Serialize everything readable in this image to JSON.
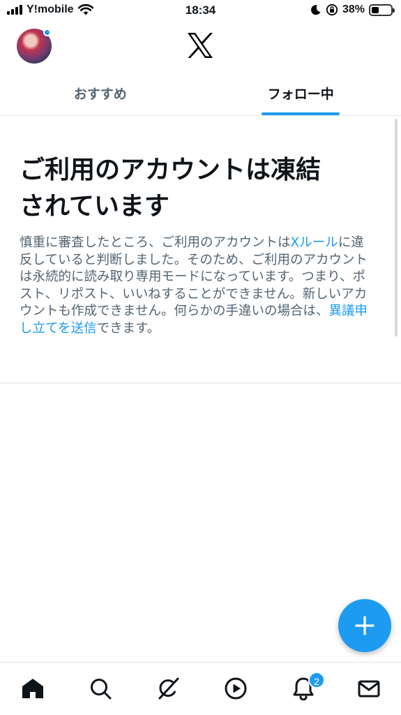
{
  "status_bar": {
    "carrier": "Y!mobile",
    "time": "18:34",
    "battery_percent": "38%",
    "battery_level": 0.38,
    "icons": [
      "signal-icon",
      "wifi-icon",
      "moon-icon",
      "orientation-lock-icon",
      "battery-icon"
    ]
  },
  "header": {
    "avatar_icon": "avatar",
    "logo_icon": "x-logo-icon"
  },
  "tabs": [
    {
      "label": "おすすめ",
      "active": false
    },
    {
      "label": "フォロー中",
      "active": true
    }
  ],
  "notice": {
    "title_line1": "ご利用のアカウントは凍結",
    "title_line2": "されています",
    "body_part1": "慎重に審査したところ、ご利用のアカウントは",
    "rules_link": "Xルール",
    "body_part2": "に違反していると判断しました。そのため、ご利用のアカウントは永続的に読み取り専用モードになっています。つまり、ポスト、リポスト、いいねすることができません。新しいアカウントも作成できません。何らかの手違いの場合は、",
    "appeal_link": "異議申し立てを送信",
    "body_part3": "できます。"
  },
  "fab": {
    "icon": "plus-icon"
  },
  "bottom_nav": {
    "items": [
      "home-icon",
      "search-icon",
      "grok-icon",
      "video-icon",
      "notifications-icon",
      "messages-icon"
    ],
    "notification_badge": "2"
  },
  "colors": {
    "accent": "#1d9bf0",
    "text_primary": "#0f1419",
    "text_secondary": "#536471",
    "divider": "#e3e3e3"
  }
}
